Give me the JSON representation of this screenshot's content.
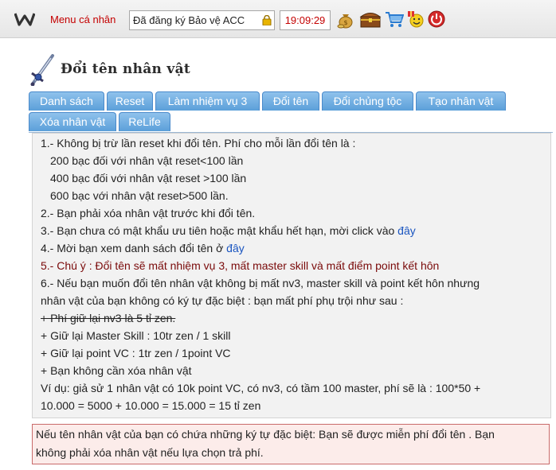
{
  "topbar": {
    "logo": "w-logo",
    "menu_label": "Menu cá nhân",
    "status_text": "Đã đăng ký Bảo vệ ACC",
    "status_icon": "lock-icon",
    "clock": "19:09:29",
    "icons": [
      "money-bag-icon",
      "treasure-chest-icon",
      "shopping-cart-icon",
      "gift-smiley-icon",
      "power-icon"
    ]
  },
  "page": {
    "title": "Đổi tên nhân vật",
    "title_icon": "sword-icon"
  },
  "tabs": [
    "Danh sách",
    "Reset",
    "Làm nhiệm vụ 3",
    "Đổi tên",
    "Đổi chủng tộc",
    "Tạo nhân vật",
    "Xóa nhân vật",
    "ReLife"
  ],
  "info": {
    "l1": "1.- Không bị trừ lần reset khi đổi tên. Phí cho mỗi lần đổi tên là :",
    "l2": "200 bạc đối với nhân vật reset<100 lần",
    "l3": "400 bạc đối với nhân vật reset >100 lần",
    "l4": "600 bạc với nhân vật reset>500 lần.",
    "l5": "2.- Bạn phải xóa nhân vật trước khi đổi tên.",
    "l6": "3.- Bạn chưa có mật khẩu ưu tiên hoặc mật khẩu hết hạn, mời click vào ",
    "l6_link": "đây",
    "l7": "4.- Mời bạn xem danh sách đổi tên ở ",
    "l7_link": "đây",
    "l8": "5.- Chú ý : Đổi tên sẽ mất nhiệm vụ 3, mất master skill và mất điểm point kết hôn",
    "l9": "6.- Nếu bạn muốn đổi tên nhân vật không bị mất nv3, master skill và point kết hôn nhưng",
    "l10": "nhân vật của bạn không có ký tự đặc biệt : bạn mất phí phụ trội như sau :",
    "l11": "+ Phí giữ lại nv3 là 5 tỉ zen.",
    "l12": "+ Giữ lại Master Skill : 10tr zen / 1 skill",
    "l13": "+ Giữ lại point VC : 1tr zen / 1point VC",
    "l14": "+ Bạn không cần xóa nhân vật",
    "l15": "Ví dụ: giả sử 1 nhân vật có 10k point VC, có nv3, có tầm 100 master, phí sẽ là : 100*50 +",
    "l16": "10.000 = 5000 + 10.000 = 15.000 = 15 tỉ zen"
  },
  "notice": {
    "l1": "Nếu tên nhân vật của bạn có chứa những ký tự đặc biệt: Bạn sẽ được miễn phí đổi tên . Bạn",
    "l2": "không phải xóa nhân vật nếu lựa chọn trả phí."
  },
  "colors": {
    "tab_bg": "#5b9fd9",
    "accent_red": "#c40000",
    "link": "#1a55c0",
    "notice_bg": "#fcecea",
    "notice_border": "#c96a6a"
  }
}
